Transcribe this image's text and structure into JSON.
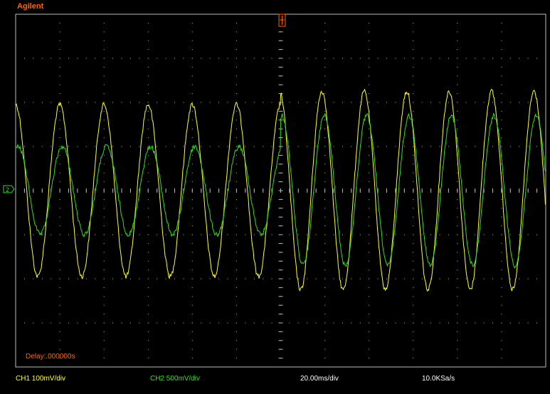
{
  "brand": "Agilent",
  "delay": "Delay:.000000s",
  "status": {
    "ch1": "CH1 100mV/div",
    "ch2": "CH2 500mV/div",
    "timebase": "20.00ms/div",
    "sample_rate": "10.0KSa/s"
  },
  "colors": {
    "ch1": "#ffff33",
    "ch2": "#33dd22",
    "brand": "#ff6600",
    "grid": "#bbbbbb"
  },
  "icons": {
    "trigger_marker": "trigger-position-icon",
    "ground_marker": "ground-level-icon"
  },
  "chart_data": {
    "type": "line",
    "grid": true,
    "x_divisions": 12,
    "y_divisions": 8,
    "series": [
      {
        "channel": "CH1",
        "color": "#ffff33",
        "segments": [
          {
            "period_divs": 1.0,
            "amplitude_divs": 1.95,
            "phase_deg": 90
          },
          {
            "period_divs": 0.96,
            "amplitude_divs": 2.25,
            "phase_deg": 100
          }
        ]
      },
      {
        "channel": "CH2",
        "color": "#33dd22",
        "segments": [
          {
            "period_divs": 1.0,
            "amplitude_divs": 1.0,
            "phase_deg": 70
          },
          {
            "period_divs": 0.96,
            "amplitude_divs": 1.7,
            "phase_deg": 80
          }
        ]
      }
    ]
  }
}
